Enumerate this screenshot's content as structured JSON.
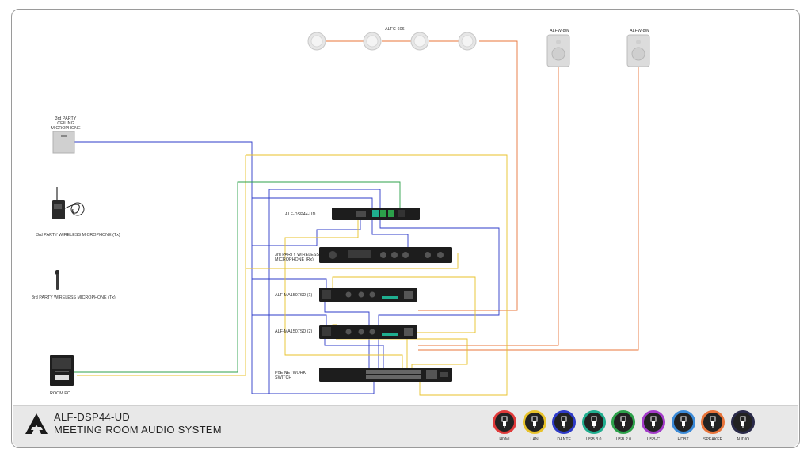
{
  "diagram": {
    "devices": {
      "ceiling_speaker_group": "ALFC-606",
      "wall_speaker_1": "ALFW-8W",
      "wall_speaker_2": "ALFW-8W",
      "ceiling_microphone": "3rd PARTY CEILING MICROPHONE",
      "wireless_bodypack": "3rd PARTY WIRELESS MICROPHONE (Tx)",
      "wireless_handheld": "3rd PARTY WIRELESS MICROPHONE (Tx)",
      "room_pc": "ROOM PC",
      "dsp": "ALF-DSP44-UD",
      "wireless_receiver": "3rd PARTY WIRELESS MICROPHONE (Rx)",
      "amp_1": "ALF-MA1507SD (1)",
      "amp_2": "ALF-MA1507SD (2)",
      "network_switch": "PoE NETWORK SWITCH"
    }
  },
  "footer": {
    "title_line1": "ALF-DSP44-UD",
    "title_line2": "MEETING ROOM AUDIO SYSTEM"
  },
  "legend": [
    {
      "label": "HDMI",
      "color": "#e03a3a",
      "icon": "hdmi-icon"
    },
    {
      "label": "LAN",
      "color": "#e8c22a",
      "icon": "lan-icon"
    },
    {
      "label": "DANTE",
      "color": "#2e3bc9",
      "icon": "dante-icon"
    },
    {
      "label": "USB 3.0",
      "color": "#1fae8f",
      "icon": "usb3-icon"
    },
    {
      "label": "USB 2.0",
      "color": "#2ca14a",
      "icon": "usb2-icon"
    },
    {
      "label": "USB-C",
      "color": "#a33bc9",
      "icon": "usbc-icon"
    },
    {
      "label": "HDBT",
      "color": "#3a8ad8",
      "icon": "hdbt-icon"
    },
    {
      "label": "SPEAKER",
      "color": "#e8743a",
      "icon": "speaker-icon"
    },
    {
      "label": "AUDIO",
      "color": "#2a2a4a",
      "icon": "audio-icon"
    }
  ]
}
